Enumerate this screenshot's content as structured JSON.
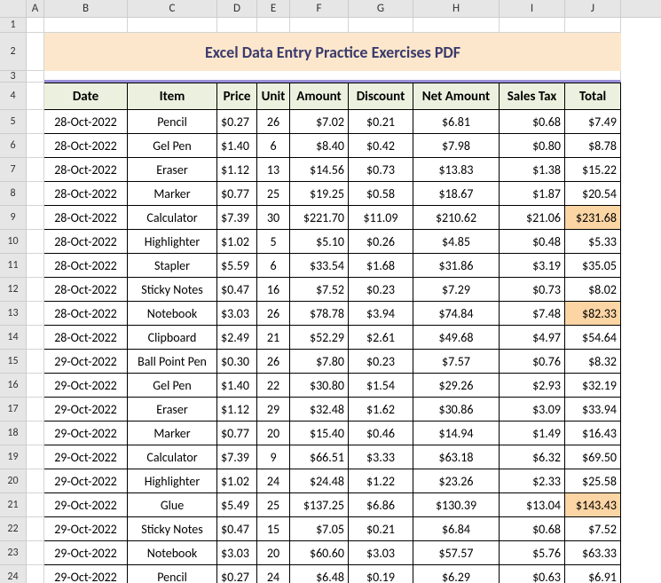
{
  "title": "Excel Data Entry Practice Exercises PDF",
  "cols": [
    "A",
    "B",
    "C",
    "D",
    "E",
    "F",
    "G",
    "H",
    "I",
    "J"
  ],
  "colWidths": [
    "wA",
    "wB",
    "wC",
    "wD",
    "wE",
    "wF",
    "wG",
    "wH",
    "wI",
    "wJ"
  ],
  "rowNums": [
    1,
    2,
    3,
    4,
    5,
    6,
    7,
    8,
    9,
    10,
    11,
    12,
    13,
    14,
    15,
    16,
    17,
    18,
    19,
    20,
    21,
    22,
    23,
    24
  ],
  "headers": [
    "Date",
    "Item",
    "Price",
    "Unit",
    "Amount",
    "Discount",
    "Net Amount",
    "Sales Tax",
    "Total"
  ],
  "rows": [
    {
      "date": "28-Oct-2022",
      "item": "Pencil",
      "price": "$0.27",
      "unit": "26",
      "amount": "$7.02",
      "discount": "$0.21",
      "net": "$6.81",
      "tax": "$0.68",
      "total": "$7.49",
      "hl": false
    },
    {
      "date": "28-Oct-2022",
      "item": "Gel Pen",
      "price": "$1.40",
      "unit": "6",
      "amount": "$8.40",
      "discount": "$0.42",
      "net": "$7.98",
      "tax": "$0.80",
      "total": "$8.78",
      "hl": false
    },
    {
      "date": "28-Oct-2022",
      "item": "Eraser",
      "price": "$1.12",
      "unit": "13",
      "amount": "$14.56",
      "discount": "$0.73",
      "net": "$13.83",
      "tax": "$1.38",
      "total": "$15.22",
      "hl": false
    },
    {
      "date": "28-Oct-2022",
      "item": "Marker",
      "price": "$0.77",
      "unit": "25",
      "amount": "$19.25",
      "discount": "$0.58",
      "net": "$18.67",
      "tax": "$1.87",
      "total": "$20.54",
      "hl": false
    },
    {
      "date": "28-Oct-2022",
      "item": "Calculator",
      "price": "$7.39",
      "unit": "30",
      "amount": "$221.70",
      "discount": "$11.09",
      "net": "$210.62",
      "tax": "$21.06",
      "total": "$231.68",
      "hl": true
    },
    {
      "date": "28-Oct-2022",
      "item": "Highlighter",
      "price": "$1.02",
      "unit": "5",
      "amount": "$5.10",
      "discount": "$0.26",
      "net": "$4.85",
      "tax": "$0.48",
      "total": "$5.33",
      "hl": false
    },
    {
      "date": "28-Oct-2022",
      "item": "Stapler",
      "price": "$5.59",
      "unit": "6",
      "amount": "$33.54",
      "discount": "$1.68",
      "net": "$31.86",
      "tax": "$3.19",
      "total": "$35.05",
      "hl": false
    },
    {
      "date": "28-Oct-2022",
      "item": "Sticky Notes",
      "price": "$0.47",
      "unit": "16",
      "amount": "$7.52",
      "discount": "$0.23",
      "net": "$7.29",
      "tax": "$0.73",
      "total": "$8.02",
      "hl": false
    },
    {
      "date": "28-Oct-2022",
      "item": "Notebook",
      "price": "$3.03",
      "unit": "26",
      "amount": "$78.78",
      "discount": "$3.94",
      "net": "$74.84",
      "tax": "$7.48",
      "total": "$82.33",
      "hl": true
    },
    {
      "date": "28-Oct-2022",
      "item": "Clipboard",
      "price": "$2.49",
      "unit": "21",
      "amount": "$52.29",
      "discount": "$2.61",
      "net": "$49.68",
      "tax": "$4.97",
      "total": "$54.64",
      "hl": false
    },
    {
      "date": "29-Oct-2022",
      "item": "Ball Point Pen",
      "price": "$0.30",
      "unit": "26",
      "amount": "$7.80",
      "discount": "$0.23",
      "net": "$7.57",
      "tax": "$0.76",
      "total": "$8.32",
      "hl": false
    },
    {
      "date": "29-Oct-2022",
      "item": "Gel Pen",
      "price": "$1.40",
      "unit": "22",
      "amount": "$30.80",
      "discount": "$1.54",
      "net": "$29.26",
      "tax": "$2.93",
      "total": "$32.19",
      "hl": false
    },
    {
      "date": "29-Oct-2022",
      "item": "Eraser",
      "price": "$1.12",
      "unit": "29",
      "amount": "$32.48",
      "discount": "$1.62",
      "net": "$30.86",
      "tax": "$3.09",
      "total": "$33.94",
      "hl": false
    },
    {
      "date": "29-Oct-2022",
      "item": "Marker",
      "price": "$0.77",
      "unit": "20",
      "amount": "$15.40",
      "discount": "$0.46",
      "net": "$14.94",
      "tax": "$1.49",
      "total": "$16.43",
      "hl": false
    },
    {
      "date": "29-Oct-2022",
      "item": "Calculator",
      "price": "$7.39",
      "unit": "9",
      "amount": "$66.51",
      "discount": "$3.33",
      "net": "$63.18",
      "tax": "$6.32",
      "total": "$69.50",
      "hl": false
    },
    {
      "date": "29-Oct-2022",
      "item": "Highlighter",
      "price": "$1.02",
      "unit": "24",
      "amount": "$24.48",
      "discount": "$1.22",
      "net": "$23.26",
      "tax": "$2.33",
      "total": "$25.58",
      "hl": false
    },
    {
      "date": "29-Oct-2022",
      "item": "Glue",
      "price": "$5.49",
      "unit": "25",
      "amount": "$137.25",
      "discount": "$6.86",
      "net": "$130.39",
      "tax": "$13.04",
      "total": "$143.43",
      "hl": true
    },
    {
      "date": "29-Oct-2022",
      "item": "Sticky Notes",
      "price": "$0.47",
      "unit": "15",
      "amount": "$7.05",
      "discount": "$0.21",
      "net": "$6.84",
      "tax": "$0.68",
      "total": "$7.52",
      "hl": false
    },
    {
      "date": "29-Oct-2022",
      "item": "Notebook",
      "price": "$3.03",
      "unit": "20",
      "amount": "$60.60",
      "discount": "$3.03",
      "net": "$57.57",
      "tax": "$5.76",
      "total": "$63.33",
      "hl": false
    },
    {
      "date": "29-Oct-2022",
      "item": "Pencil",
      "price": "$0.27",
      "unit": "24",
      "amount": "$6.48",
      "discount": "$0.19",
      "net": "$6.29",
      "tax": "$0.63",
      "total": "$6.91",
      "hl": false
    }
  ]
}
